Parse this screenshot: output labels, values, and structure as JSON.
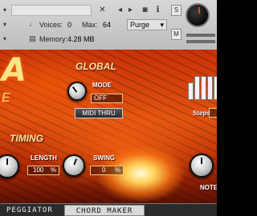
{
  "header": {
    "voices_label": "Voices:",
    "voices_value": "0",
    "max_label": "Max:",
    "max_value": "64",
    "purge_label": "Purge",
    "memory_label": "Memory:",
    "memory_value": "4.28 MB",
    "s_button": "S",
    "m_button": "M",
    "icons": [
      "close-x-icon",
      "camera-icon",
      "info-icon",
      "midi-icon",
      "memory-icon",
      "dropdown-arrow-icon"
    ]
  },
  "panel": {
    "logo_partial_letter": "A",
    "logo_partial_sub": "E",
    "global_title": "GLOBAL",
    "mode_label": "MODE",
    "mode_value": "OFF",
    "midi_thru_label": "MIDI THRU",
    "timing_title": "TIMING",
    "length_label": "LENGTH",
    "length_value": "100",
    "length_unit": "%",
    "swing_label": "SWING",
    "swing_value": "0",
    "swing_unit": "%",
    "steps_label": "Steps:",
    "note_label": "NOTE"
  },
  "tabs": {
    "arpeggiator": "PEGGIATOR",
    "chord_maker": "CHORD MAKER"
  }
}
